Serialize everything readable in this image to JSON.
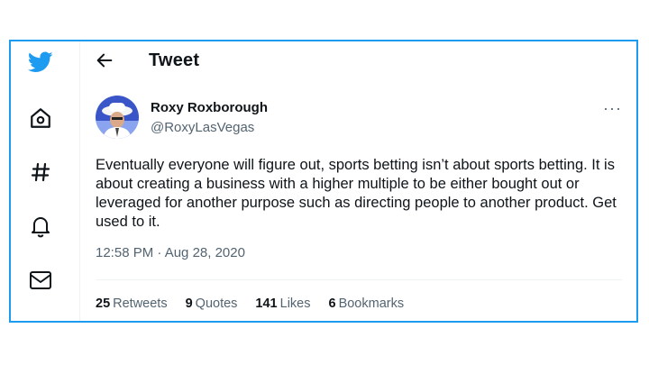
{
  "sidebar": {
    "icons": [
      "twitter-bird-icon",
      "home-icon",
      "hashtag-icon",
      "bell-icon",
      "mail-icon"
    ]
  },
  "header": {
    "title": "Tweet"
  },
  "tweet": {
    "author_name": "Roxy Roxborough",
    "author_handle": "@RoxyLasVegas",
    "text": "Eventually everyone will figure out, sports betting isn’t about sports betting. It is about creating a business with a higher multiple to be either bought out or leveraged for another purpose such as directing people to another product. Get used to it.",
    "timestamp": "12:58 PM · Aug 28, 2020",
    "more_label": "···"
  },
  "stats": [
    {
      "count": "25",
      "label": "Retweets"
    },
    {
      "count": "9",
      "label": "Quotes"
    },
    {
      "count": "141",
      "label": "Likes"
    },
    {
      "count": "6",
      "label": "Bookmarks"
    }
  ],
  "colors": {
    "accent": "#1d9bf0",
    "text": "#0f1419",
    "muted": "#536471"
  }
}
